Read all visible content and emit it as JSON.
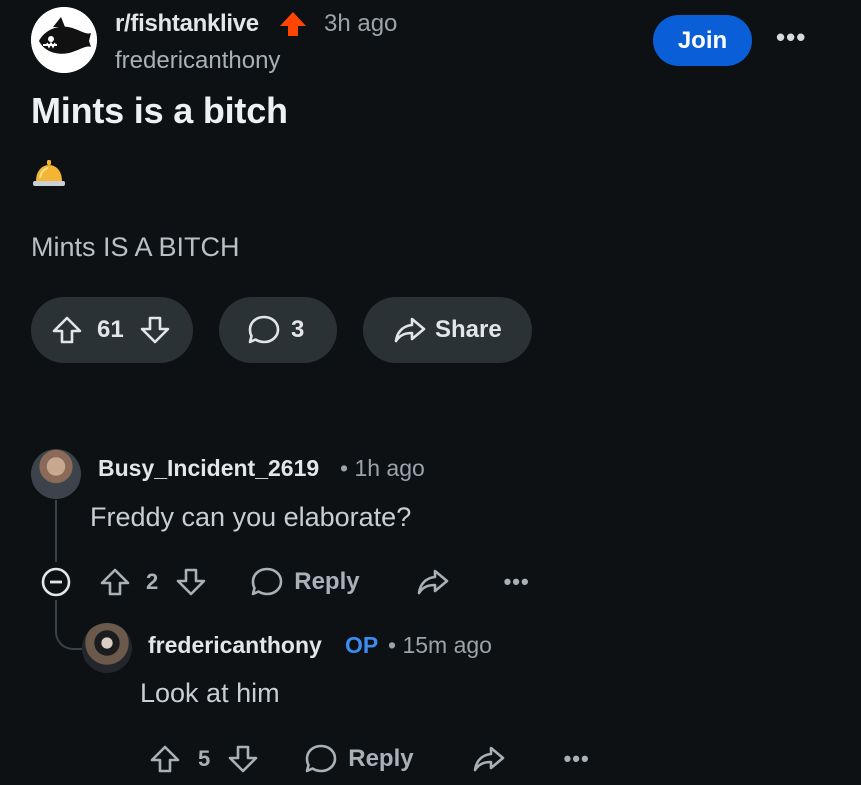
{
  "post": {
    "subreddit": "r/fishtanklive",
    "time": "3h ago",
    "author": "fredericanthony",
    "join_label": "Join",
    "more_label": "•••",
    "title": "Mints is a bitch",
    "body": "Mints IS A BITCH",
    "votes": "61",
    "comments": "3",
    "share_label": "Share"
  },
  "comments": [
    {
      "user": "Busy_Incident_2619",
      "meta": "• 1h ago",
      "text": "Freddy can you elaborate?",
      "votes": "2",
      "reply_label": "Reply",
      "more_label": "•••"
    },
    {
      "user": "fredericanthony",
      "op_label": "OP",
      "meta": "• 15m ago",
      "text": "Look at him",
      "votes": "5",
      "reply_label": "Reply",
      "more_label": "•••"
    }
  ],
  "icons": {
    "subreddit_avatar": "fish-logo-icon",
    "trending": "trending-up-arrow-icon",
    "bell": "bellhop-bell-icon",
    "upvote": "upvote-arrow-icon",
    "downvote": "downvote-arrow-icon",
    "comment": "comment-bubble-icon",
    "share": "share-arrow-icon",
    "collapse": "collapse-minus-icon"
  },
  "colors": {
    "background": "#0e1113",
    "join_button": "#0a5ed7",
    "op_badge": "#3c8bef",
    "trending": "#ff4500"
  }
}
